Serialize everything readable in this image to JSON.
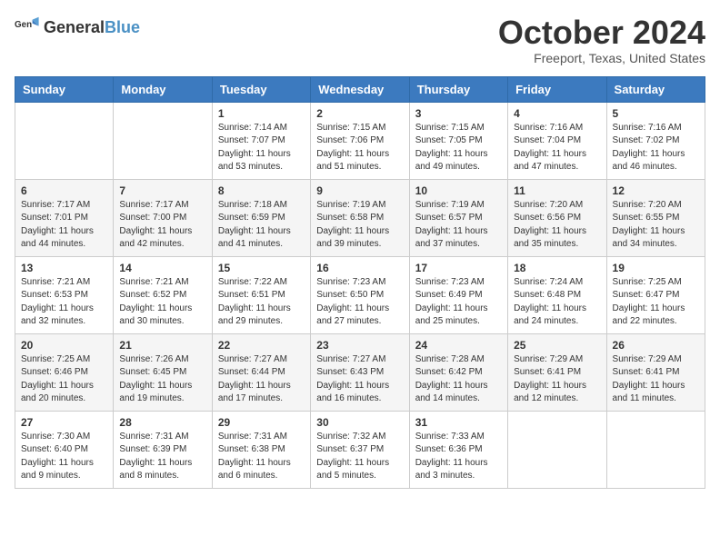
{
  "header": {
    "logo_general": "General",
    "logo_blue": "Blue",
    "month": "October 2024",
    "location": "Freeport, Texas, United States"
  },
  "days_of_week": [
    "Sunday",
    "Monday",
    "Tuesday",
    "Wednesday",
    "Thursday",
    "Friday",
    "Saturday"
  ],
  "weeks": [
    [
      {
        "day": "",
        "sunrise": "",
        "sunset": "",
        "daylight": ""
      },
      {
        "day": "",
        "sunrise": "",
        "sunset": "",
        "daylight": ""
      },
      {
        "day": "1",
        "sunrise": "Sunrise: 7:14 AM",
        "sunset": "Sunset: 7:07 PM",
        "daylight": "Daylight: 11 hours and 53 minutes."
      },
      {
        "day": "2",
        "sunrise": "Sunrise: 7:15 AM",
        "sunset": "Sunset: 7:06 PM",
        "daylight": "Daylight: 11 hours and 51 minutes."
      },
      {
        "day": "3",
        "sunrise": "Sunrise: 7:15 AM",
        "sunset": "Sunset: 7:05 PM",
        "daylight": "Daylight: 11 hours and 49 minutes."
      },
      {
        "day": "4",
        "sunrise": "Sunrise: 7:16 AM",
        "sunset": "Sunset: 7:04 PM",
        "daylight": "Daylight: 11 hours and 47 minutes."
      },
      {
        "day": "5",
        "sunrise": "Sunrise: 7:16 AM",
        "sunset": "Sunset: 7:02 PM",
        "daylight": "Daylight: 11 hours and 46 minutes."
      }
    ],
    [
      {
        "day": "6",
        "sunrise": "Sunrise: 7:17 AM",
        "sunset": "Sunset: 7:01 PM",
        "daylight": "Daylight: 11 hours and 44 minutes."
      },
      {
        "day": "7",
        "sunrise": "Sunrise: 7:17 AM",
        "sunset": "Sunset: 7:00 PM",
        "daylight": "Daylight: 11 hours and 42 minutes."
      },
      {
        "day": "8",
        "sunrise": "Sunrise: 7:18 AM",
        "sunset": "Sunset: 6:59 PM",
        "daylight": "Daylight: 11 hours and 41 minutes."
      },
      {
        "day": "9",
        "sunrise": "Sunrise: 7:19 AM",
        "sunset": "Sunset: 6:58 PM",
        "daylight": "Daylight: 11 hours and 39 minutes."
      },
      {
        "day": "10",
        "sunrise": "Sunrise: 7:19 AM",
        "sunset": "Sunset: 6:57 PM",
        "daylight": "Daylight: 11 hours and 37 minutes."
      },
      {
        "day": "11",
        "sunrise": "Sunrise: 7:20 AM",
        "sunset": "Sunset: 6:56 PM",
        "daylight": "Daylight: 11 hours and 35 minutes."
      },
      {
        "day": "12",
        "sunrise": "Sunrise: 7:20 AM",
        "sunset": "Sunset: 6:55 PM",
        "daylight": "Daylight: 11 hours and 34 minutes."
      }
    ],
    [
      {
        "day": "13",
        "sunrise": "Sunrise: 7:21 AM",
        "sunset": "Sunset: 6:53 PM",
        "daylight": "Daylight: 11 hours and 32 minutes."
      },
      {
        "day": "14",
        "sunrise": "Sunrise: 7:21 AM",
        "sunset": "Sunset: 6:52 PM",
        "daylight": "Daylight: 11 hours and 30 minutes."
      },
      {
        "day": "15",
        "sunrise": "Sunrise: 7:22 AM",
        "sunset": "Sunset: 6:51 PM",
        "daylight": "Daylight: 11 hours and 29 minutes."
      },
      {
        "day": "16",
        "sunrise": "Sunrise: 7:23 AM",
        "sunset": "Sunset: 6:50 PM",
        "daylight": "Daylight: 11 hours and 27 minutes."
      },
      {
        "day": "17",
        "sunrise": "Sunrise: 7:23 AM",
        "sunset": "Sunset: 6:49 PM",
        "daylight": "Daylight: 11 hours and 25 minutes."
      },
      {
        "day": "18",
        "sunrise": "Sunrise: 7:24 AM",
        "sunset": "Sunset: 6:48 PM",
        "daylight": "Daylight: 11 hours and 24 minutes."
      },
      {
        "day": "19",
        "sunrise": "Sunrise: 7:25 AM",
        "sunset": "Sunset: 6:47 PM",
        "daylight": "Daylight: 11 hours and 22 minutes."
      }
    ],
    [
      {
        "day": "20",
        "sunrise": "Sunrise: 7:25 AM",
        "sunset": "Sunset: 6:46 PM",
        "daylight": "Daylight: 11 hours and 20 minutes."
      },
      {
        "day": "21",
        "sunrise": "Sunrise: 7:26 AM",
        "sunset": "Sunset: 6:45 PM",
        "daylight": "Daylight: 11 hours and 19 minutes."
      },
      {
        "day": "22",
        "sunrise": "Sunrise: 7:27 AM",
        "sunset": "Sunset: 6:44 PM",
        "daylight": "Daylight: 11 hours and 17 minutes."
      },
      {
        "day": "23",
        "sunrise": "Sunrise: 7:27 AM",
        "sunset": "Sunset: 6:43 PM",
        "daylight": "Daylight: 11 hours and 16 minutes."
      },
      {
        "day": "24",
        "sunrise": "Sunrise: 7:28 AM",
        "sunset": "Sunset: 6:42 PM",
        "daylight": "Daylight: 11 hours and 14 minutes."
      },
      {
        "day": "25",
        "sunrise": "Sunrise: 7:29 AM",
        "sunset": "Sunset: 6:41 PM",
        "daylight": "Daylight: 11 hours and 12 minutes."
      },
      {
        "day": "26",
        "sunrise": "Sunrise: 7:29 AM",
        "sunset": "Sunset: 6:41 PM",
        "daylight": "Daylight: 11 hours and 11 minutes."
      }
    ],
    [
      {
        "day": "27",
        "sunrise": "Sunrise: 7:30 AM",
        "sunset": "Sunset: 6:40 PM",
        "daylight": "Daylight: 11 hours and 9 minutes."
      },
      {
        "day": "28",
        "sunrise": "Sunrise: 7:31 AM",
        "sunset": "Sunset: 6:39 PM",
        "daylight": "Daylight: 11 hours and 8 minutes."
      },
      {
        "day": "29",
        "sunrise": "Sunrise: 7:31 AM",
        "sunset": "Sunset: 6:38 PM",
        "daylight": "Daylight: 11 hours and 6 minutes."
      },
      {
        "day": "30",
        "sunrise": "Sunrise: 7:32 AM",
        "sunset": "Sunset: 6:37 PM",
        "daylight": "Daylight: 11 hours and 5 minutes."
      },
      {
        "day": "31",
        "sunrise": "Sunrise: 7:33 AM",
        "sunset": "Sunset: 6:36 PM",
        "daylight": "Daylight: 11 hours and 3 minutes."
      },
      {
        "day": "",
        "sunrise": "",
        "sunset": "",
        "daylight": ""
      },
      {
        "day": "",
        "sunrise": "",
        "sunset": "",
        "daylight": ""
      }
    ]
  ]
}
